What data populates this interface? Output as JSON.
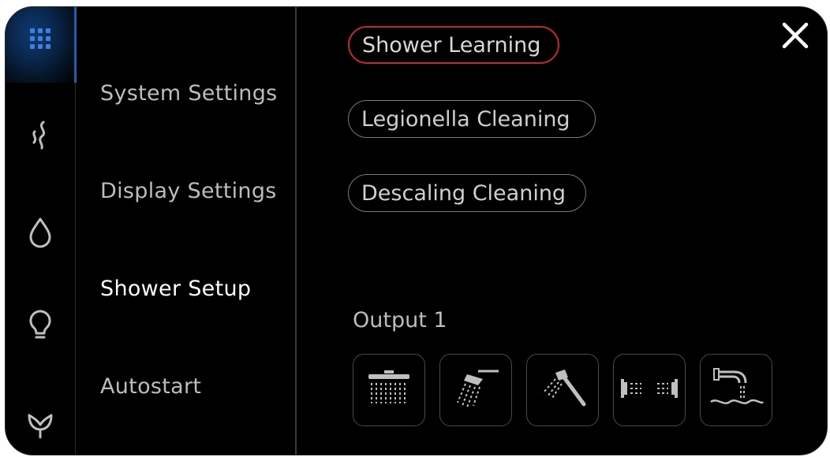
{
  "rail": {
    "items": [
      {
        "icon": "apps-grid-icon",
        "active": true
      },
      {
        "icon": "steam-icon",
        "active": false
      },
      {
        "icon": "water-drop-icon",
        "active": false
      },
      {
        "icon": "lightbulb-icon",
        "active": false
      },
      {
        "icon": "aroma-flower-icon",
        "active": false
      }
    ],
    "accent_color": "#1f5fae"
  },
  "menu": {
    "items": [
      {
        "label": "System Settings",
        "active": false
      },
      {
        "label": "Display Settings",
        "active": false
      },
      {
        "label": "Shower Setup",
        "active": true
      },
      {
        "label": "Autostart",
        "active": false
      }
    ]
  },
  "actions": {
    "shower_learning": "Shower Learning",
    "legionella_cleaning": "Legionella Cleaning",
    "descaling_cleaning": "Descaling Cleaning",
    "selected_color": "#c1272d"
  },
  "output": {
    "label": "Output 1",
    "tiles": [
      {
        "icon": "rain-shower-icon"
      },
      {
        "icon": "overhead-shower-icon"
      },
      {
        "icon": "hand-shower-icon"
      },
      {
        "icon": "body-jets-icon"
      },
      {
        "icon": "bath-spout-icon"
      }
    ]
  },
  "close_icon": "close-icon"
}
